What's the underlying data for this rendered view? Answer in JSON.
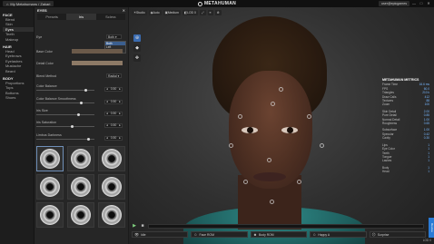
{
  "topbar": {
    "project_tab": "My Metahumans / Zakari",
    "brand": "METAHUMAN",
    "account": "user@epicgames",
    "win_controls": [
      "—",
      "□",
      "✕"
    ]
  },
  "leftnav": [
    {
      "section": "FACE",
      "items": [
        "Blend",
        "Skin",
        "Eyes",
        "Teeth",
        "Makeup"
      ],
      "active": "Eyes"
    },
    {
      "section": "HAIR",
      "items": [
        "Head",
        "Eyebrows",
        "Eyelashes",
        "Mustache",
        "Beard"
      ]
    },
    {
      "section": "BODY",
      "items": [
        "Proportions",
        "Tops",
        "Bottoms",
        "Shoes"
      ]
    }
  ],
  "panel": {
    "title": "EYES",
    "close": "✕",
    "tabs": [
      "Presets",
      "Iris",
      "Sclera"
    ],
    "active_tab": "Iris",
    "type_label": "Eye",
    "type_value": "Both",
    "dropdown_options": [
      "Both",
      "Left",
      "Right"
    ],
    "dropdown_selected": "Both",
    "base_color_label": "Base Color",
    "base_color": "#6b5a4a",
    "detail_color_label": "Detail Color",
    "detail_color": "#8d7a66",
    "blend_label": "Blend Method",
    "blend_value": "Radial",
    "sliders": [
      {
        "label": "Color Balance",
        "value": "0.50",
        "level": 0.85
      },
      {
        "label": "Color Balance Smoothness",
        "value": "0.50",
        "level": 0.78
      },
      {
        "label": "Iris Size",
        "value": "0.50",
        "level": 0.72
      },
      {
        "label": "Iris Saturation",
        "value": "0.50",
        "level": 0.62
      },
      {
        "label": "Limbus Darkness",
        "value": "0.50",
        "level": 0.9
      }
    ],
    "iris_presets": 9,
    "selected_preset": 0
  },
  "viewport": {
    "toolbar": [
      "Studio",
      "Auto",
      "Medium",
      "LOD 0",
      "⤢",
      "≡",
      "⚙"
    ],
    "side_tools": [
      "⊕",
      "◆",
      "✥"
    ],
    "metrics_title": "METAHUMAN METRICS",
    "metrics": [
      {
        "k": "Frame Time",
        "v": "16.6 ms"
      },
      {
        "k": "FPS",
        "v": "60.0"
      },
      {
        "k": "Triangles",
        "v": "210 k"
      },
      {
        "k": "Draw Calls",
        "v": "412"
      },
      {
        "k": "Textures",
        "v": "88"
      },
      {
        "k": "Zoom",
        "v": "100"
      },
      {
        "k": "gap",
        "v": ""
      },
      {
        "k": "Skin Detail",
        "v": "2.00"
      },
      {
        "k": "Pore Detail",
        "v": "0.85"
      },
      {
        "k": "Normal Detail",
        "v": "1.00"
      },
      {
        "k": "Roughness",
        "v": "0.65"
      },
      {
        "k": "gap",
        "v": ""
      },
      {
        "k": "Subsurface",
        "v": "1.00"
      },
      {
        "k": "Specular",
        "v": "0.42"
      },
      {
        "k": "Cavity",
        "v": "0.30"
      },
      {
        "k": "gap",
        "v": ""
      },
      {
        "k": "Lips",
        "v": "1"
      },
      {
        "k": "Eye Color",
        "v": "1"
      },
      {
        "k": "Teeth",
        "v": "1"
      },
      {
        "k": "Tongue",
        "v": "1"
      },
      {
        "k": "Lashes",
        "v": "1"
      },
      {
        "k": "gap",
        "v": ""
      },
      {
        "k": "Body",
        "v": "1"
      },
      {
        "k": "Head",
        "v": "1"
      }
    ],
    "bottom_buttons": [
      {
        "icon": "👁",
        "label": "Idle"
      },
      {
        "icon": "☺",
        "label": "Face ROM"
      },
      {
        "icon": "☻",
        "label": "Body ROM"
      },
      {
        "icon": "☺",
        "label": "Happy A"
      },
      {
        "icon": "☹",
        "label": "Surprise"
      }
    ],
    "side_tab": "Review",
    "corner": "LOD 0"
  }
}
